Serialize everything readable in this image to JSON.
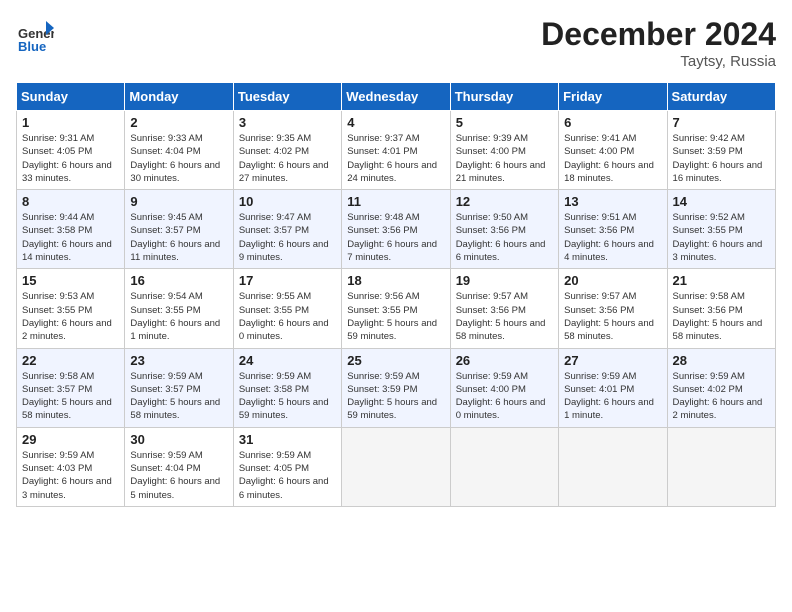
{
  "header": {
    "logo_general": "General",
    "logo_blue": "Blue",
    "month_title": "December 2024",
    "location": "Taytsy, Russia"
  },
  "weekdays": [
    "Sunday",
    "Monday",
    "Tuesday",
    "Wednesday",
    "Thursday",
    "Friday",
    "Saturday"
  ],
  "weeks": [
    [
      {
        "day": "1",
        "sunrise": "Sunrise: 9:31 AM",
        "sunset": "Sunset: 4:05 PM",
        "daylight": "Daylight: 6 hours and 33 minutes."
      },
      {
        "day": "2",
        "sunrise": "Sunrise: 9:33 AM",
        "sunset": "Sunset: 4:04 PM",
        "daylight": "Daylight: 6 hours and 30 minutes."
      },
      {
        "day": "3",
        "sunrise": "Sunrise: 9:35 AM",
        "sunset": "Sunset: 4:02 PM",
        "daylight": "Daylight: 6 hours and 27 minutes."
      },
      {
        "day": "4",
        "sunrise": "Sunrise: 9:37 AM",
        "sunset": "Sunset: 4:01 PM",
        "daylight": "Daylight: 6 hours and 24 minutes."
      },
      {
        "day": "5",
        "sunrise": "Sunrise: 9:39 AM",
        "sunset": "Sunset: 4:00 PM",
        "daylight": "Daylight: 6 hours and 21 minutes."
      },
      {
        "day": "6",
        "sunrise": "Sunrise: 9:41 AM",
        "sunset": "Sunset: 4:00 PM",
        "daylight": "Daylight: 6 hours and 18 minutes."
      },
      {
        "day": "7",
        "sunrise": "Sunrise: 9:42 AM",
        "sunset": "Sunset: 3:59 PM",
        "daylight": "Daylight: 6 hours and 16 minutes."
      }
    ],
    [
      {
        "day": "8",
        "sunrise": "Sunrise: 9:44 AM",
        "sunset": "Sunset: 3:58 PM",
        "daylight": "Daylight: 6 hours and 14 minutes."
      },
      {
        "day": "9",
        "sunrise": "Sunrise: 9:45 AM",
        "sunset": "Sunset: 3:57 PM",
        "daylight": "Daylight: 6 hours and 11 minutes."
      },
      {
        "day": "10",
        "sunrise": "Sunrise: 9:47 AM",
        "sunset": "Sunset: 3:57 PM",
        "daylight": "Daylight: 6 hours and 9 minutes."
      },
      {
        "day": "11",
        "sunrise": "Sunrise: 9:48 AM",
        "sunset": "Sunset: 3:56 PM",
        "daylight": "Daylight: 6 hours and 7 minutes."
      },
      {
        "day": "12",
        "sunrise": "Sunrise: 9:50 AM",
        "sunset": "Sunset: 3:56 PM",
        "daylight": "Daylight: 6 hours and 6 minutes."
      },
      {
        "day": "13",
        "sunrise": "Sunrise: 9:51 AM",
        "sunset": "Sunset: 3:56 PM",
        "daylight": "Daylight: 6 hours and 4 minutes."
      },
      {
        "day": "14",
        "sunrise": "Sunrise: 9:52 AM",
        "sunset": "Sunset: 3:55 PM",
        "daylight": "Daylight: 6 hours and 3 minutes."
      }
    ],
    [
      {
        "day": "15",
        "sunrise": "Sunrise: 9:53 AM",
        "sunset": "Sunset: 3:55 PM",
        "daylight": "Daylight: 6 hours and 2 minutes."
      },
      {
        "day": "16",
        "sunrise": "Sunrise: 9:54 AM",
        "sunset": "Sunset: 3:55 PM",
        "daylight": "Daylight: 6 hours and 1 minute."
      },
      {
        "day": "17",
        "sunrise": "Sunrise: 9:55 AM",
        "sunset": "Sunset: 3:55 PM",
        "daylight": "Daylight: 6 hours and 0 minutes."
      },
      {
        "day": "18",
        "sunrise": "Sunrise: 9:56 AM",
        "sunset": "Sunset: 3:55 PM",
        "daylight": "Daylight: 5 hours and 59 minutes."
      },
      {
        "day": "19",
        "sunrise": "Sunrise: 9:57 AM",
        "sunset": "Sunset: 3:56 PM",
        "daylight": "Daylight: 5 hours and 58 minutes."
      },
      {
        "day": "20",
        "sunrise": "Sunrise: 9:57 AM",
        "sunset": "Sunset: 3:56 PM",
        "daylight": "Daylight: 5 hours and 58 minutes."
      },
      {
        "day": "21",
        "sunrise": "Sunrise: 9:58 AM",
        "sunset": "Sunset: 3:56 PM",
        "daylight": "Daylight: 5 hours and 58 minutes."
      }
    ],
    [
      {
        "day": "22",
        "sunrise": "Sunrise: 9:58 AM",
        "sunset": "Sunset: 3:57 PM",
        "daylight": "Daylight: 5 hours and 58 minutes."
      },
      {
        "day": "23",
        "sunrise": "Sunrise: 9:59 AM",
        "sunset": "Sunset: 3:57 PM",
        "daylight": "Daylight: 5 hours and 58 minutes."
      },
      {
        "day": "24",
        "sunrise": "Sunrise: 9:59 AM",
        "sunset": "Sunset: 3:58 PM",
        "daylight": "Daylight: 5 hours and 59 minutes."
      },
      {
        "day": "25",
        "sunrise": "Sunrise: 9:59 AM",
        "sunset": "Sunset: 3:59 PM",
        "daylight": "Daylight: 5 hours and 59 minutes."
      },
      {
        "day": "26",
        "sunrise": "Sunrise: 9:59 AM",
        "sunset": "Sunset: 4:00 PM",
        "daylight": "Daylight: 6 hours and 0 minutes."
      },
      {
        "day": "27",
        "sunrise": "Sunrise: 9:59 AM",
        "sunset": "Sunset: 4:01 PM",
        "daylight": "Daylight: 6 hours and 1 minute."
      },
      {
        "day": "28",
        "sunrise": "Sunrise: 9:59 AM",
        "sunset": "Sunset: 4:02 PM",
        "daylight": "Daylight: 6 hours and 2 minutes."
      }
    ],
    [
      {
        "day": "29",
        "sunrise": "Sunrise: 9:59 AM",
        "sunset": "Sunset: 4:03 PM",
        "daylight": "Daylight: 6 hours and 3 minutes."
      },
      {
        "day": "30",
        "sunrise": "Sunrise: 9:59 AM",
        "sunset": "Sunset: 4:04 PM",
        "daylight": "Daylight: 6 hours and 5 minutes."
      },
      {
        "day": "31",
        "sunrise": "Sunrise: 9:59 AM",
        "sunset": "Sunset: 4:05 PM",
        "daylight": "Daylight: 6 hours and 6 minutes."
      },
      null,
      null,
      null,
      null
    ]
  ]
}
